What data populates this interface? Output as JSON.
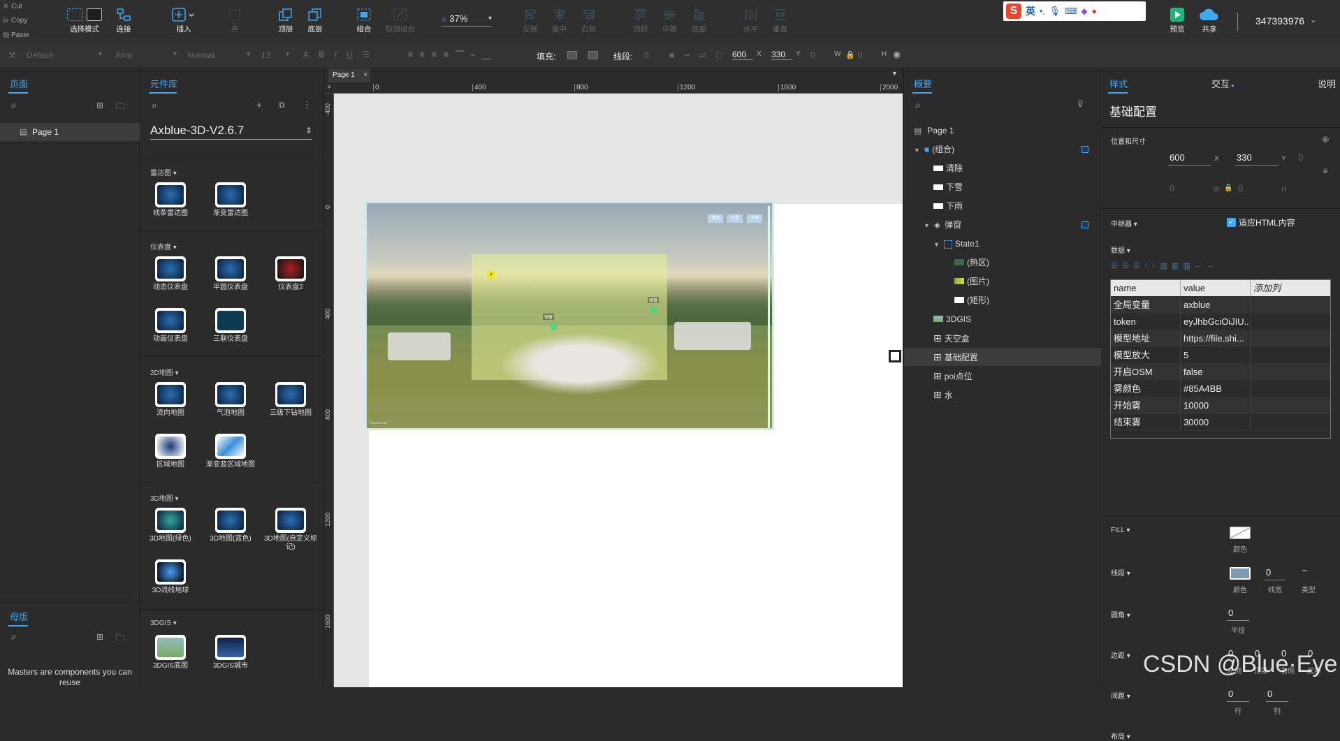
{
  "clipboard": {
    "cut": "Cut",
    "copy": "Copy",
    "paste": "Paste"
  },
  "toolbar": {
    "select_mode": "选择模式",
    "connect": "连接",
    "insert": "插入",
    "point": "点",
    "top_layer": "顶层",
    "bottom_layer": "底层",
    "group": "组合",
    "ungroup": "取消组合",
    "zoom": "37%",
    "align_left": "左侧",
    "align_center": "居中",
    "align_right": "右侧",
    "align_top": "顶部",
    "align_middle": "中部",
    "align_bottom": "底部",
    "dist_h": "水平",
    "dist_v": "垂直",
    "preview": "预览",
    "share": "共享",
    "user": "347393976"
  },
  "ime": {
    "lang": "英"
  },
  "formatbar": {
    "style": "Default",
    "font": "Arial",
    "weight": "Normal",
    "size": "13",
    "fill_label": "填充:",
    "line_label": "线段:",
    "line_value": "0",
    "x": "600",
    "x_label": "X",
    "y": "330",
    "y_label": "Y",
    "y2": "0",
    "w_label": "W",
    "w_val": "0",
    "h_label": "H"
  },
  "pages_panel": {
    "tab": "页面",
    "page": "Page 1"
  },
  "masters_panel": {
    "tab": "母版",
    "text": "Masters are components you can reuse"
  },
  "library": {
    "tab": "元件库",
    "name": "Axblue-3D-V2.6.7",
    "sections": [
      {
        "title": "雷达图 ▾",
        "items": [
          "线条雷达图",
          "渐变雷达图"
        ]
      },
      {
        "title": "仪表盘 ▾",
        "items": [
          "动态仪表盘",
          "半圆仪表盘",
          "仪表盘2",
          "动画仪表盘",
          "三联仪表盘"
        ]
      },
      {
        "title": "2D地图 ▾",
        "items": [
          "流向地图",
          "气泡地图",
          "三级下钻地图",
          "区域地图",
          "渐变蓝区域地图"
        ]
      },
      {
        "title": "3D地图 ▾",
        "items": [
          "3D地图(绿色)",
          "3D地图(蓝色)",
          "3D地图(自定义标记)",
          "3D流线地球"
        ]
      },
      {
        "title": "3DGIS ▾",
        "items": [
          "3DGIS底图",
          "3DGIS城市"
        ]
      }
    ]
  },
  "canvas": {
    "tab": "Page 1",
    "ruler_h": [
      "0",
      "400",
      "800",
      "1200",
      "1600",
      "2000"
    ],
    "ruler_v": [
      "-400",
      "0",
      "400",
      "800",
      "1200",
      "1600"
    ],
    "scene_buttons": [
      "清除",
      "下雪",
      "下雨"
    ],
    "scene_labels": [
      "弹窗",
      "弹窗"
    ],
    "credits": "Cesium ion"
  },
  "outline": {
    "tab": "概要",
    "items": [
      {
        "label": "Page 1",
        "indent": 0
      },
      {
        "label": "(组合)",
        "indent": 1
      },
      {
        "label": "清除",
        "indent": 2
      },
      {
        "label": "下雪",
        "indent": 2
      },
      {
        "label": "下雨",
        "indent": 2
      },
      {
        "label": "弹窗",
        "indent": 2
      },
      {
        "label": "State1",
        "indent": 3
      },
      {
        "label": "(热区)",
        "indent": 4
      },
      {
        "label": "(图片)",
        "indent": 4
      },
      {
        "label": "(矩形)",
        "indent": 4
      },
      {
        "label": "3DGIS",
        "indent": 2
      },
      {
        "label": "天空盒",
        "indent": 2
      },
      {
        "label": "基础配置",
        "indent": 2,
        "selected": true
      },
      {
        "label": "poi点位",
        "indent": 2
      },
      {
        "label": "水",
        "indent": 2
      }
    ]
  },
  "inspector": {
    "tabs": [
      "样式",
      "交互",
      "说明"
    ],
    "title": "基础配置",
    "pos_size": "位置和尺寸",
    "x": "600",
    "x_label": "X",
    "y": "330",
    "y_label": "Y",
    "y2": "0",
    "w": "0",
    "w_label": "W",
    "h": "0",
    "h_label": "H",
    "repeater": "中继器 ▾",
    "fit_html": "适应HTML内容",
    "data": "数据 ▾",
    "table_head": [
      "name",
      "value",
      "添加列"
    ],
    "rows": [
      [
        "全局变量",
        "axblue"
      ],
      [
        "token",
        "eyJhbGciOiJIU..."
      ],
      [
        "模型地址",
        "https://file.shi..."
      ],
      [
        "模型放大",
        "5"
      ],
      [
        "开启OSM",
        "false"
      ],
      [
        "雾颜色",
        "#85A4BB"
      ],
      [
        "开始雾",
        "10000"
      ],
      [
        "结束雾",
        "30000"
      ]
    ],
    "fill": "FILL ▾",
    "fill_color": "颜色",
    "line": "线段 ▾",
    "line_color": "颜色",
    "line_width": "0",
    "line_width_label": "线宽",
    "line_type": "类型",
    "corner": "圆角 ▾",
    "corner_val": "0",
    "corner_label": "半径",
    "padding": "边距 ▾",
    "pad_vals": [
      "0",
      "0",
      "0",
      "0"
    ],
    "pad_labels": [
      "左侧",
      "顶部",
      "右侧",
      "底部"
    ],
    "spacing": "间距 ▾",
    "sp_vals": [
      "0",
      "0"
    ],
    "sp_labels": [
      "行",
      "列"
    ],
    "layout": "布局 ▾"
  },
  "watermark": "CSDN @Blue·Eye",
  "colors": {
    "accent": "#3fa9f5",
    "panel": "#2b2b2b",
    "fog": "#85A4BB"
  }
}
